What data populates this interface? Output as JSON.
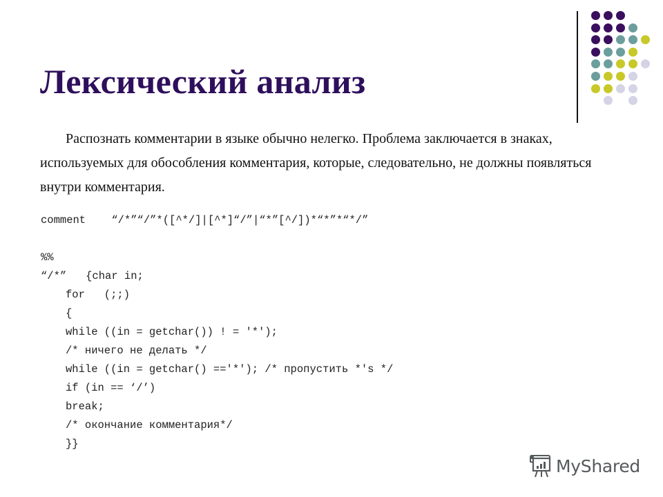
{
  "slide": {
    "title": "Лексический анализ",
    "paragraph": "Распознать комментарии в языке обычно нелегко. Проблема заключается в знаках, используемых для обособления комментария, которые, следовательно, не должны появляться внутри комментария.",
    "code_lines": [
      {
        "text": "comment    “/*”“/”*([^*/]|[^*]“/”|“*”[^/])*“*”*“*/”",
        "indent": 0
      },
      {
        "text": "%%",
        "indent": 0
      },
      {
        "text": "“/*”   {char in;",
        "indent": 0
      },
      {
        "text": "for   (;;)",
        "indent": 1
      },
      {
        "text": "{",
        "indent": 1
      },
      {
        "text": "while ((in = getchar()) ! = '*');",
        "indent": 1
      },
      {
        "text": "/* ничего не делать */",
        "indent": 1
      },
      {
        "text": "while ((in = getchar() =='*'); /* пропустить *'s */",
        "indent": 1
      },
      {
        "text": "if (in == ‘/’)",
        "indent": 1
      },
      {
        "text": "break;",
        "indent": 1
      },
      {
        "text": "/* окончание комментария*/",
        "indent": 1
      },
      {
        "text": "}}",
        "indent": 1
      }
    ]
  },
  "decoration": {
    "icon": "dot-grid-icon",
    "colors": {
      "purple": "#3a0f5e",
      "teal": "#6b9e9c",
      "yellow": "#c8c828",
      "lavender": "#d4d4e6",
      "title": "#2e0f5c"
    },
    "dot_pattern": [
      [
        "P",
        "P",
        "P",
        "",
        ""
      ],
      [
        "P",
        "P",
        "P",
        "T",
        ""
      ],
      [
        "P",
        "P",
        "T",
        "T",
        "Y"
      ],
      [
        "P",
        "T",
        "T",
        "Y",
        ""
      ],
      [
        "T",
        "T",
        "Y",
        "Y",
        "L"
      ],
      [
        "T",
        "Y",
        "Y",
        "L",
        ""
      ],
      [
        "Y",
        "Y",
        "L",
        "L",
        ""
      ],
      [
        "",
        "L",
        "",
        "L",
        ""
      ]
    ]
  },
  "watermark": {
    "icon": "presentation-board-icon",
    "text": "MyShared"
  }
}
